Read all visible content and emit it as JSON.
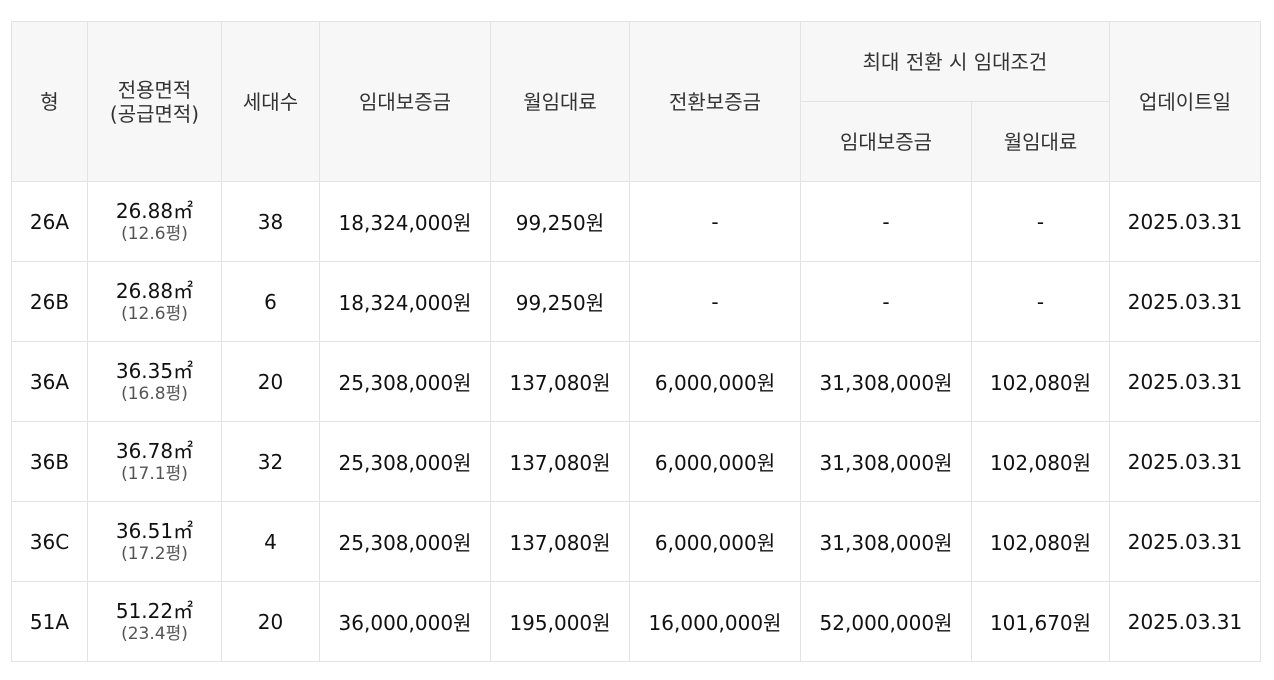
{
  "header": {
    "type": "형",
    "area_line1": "전용면적",
    "area_line2": "(공급면적)",
    "households": "세대수",
    "deposit": "임대보증금",
    "monthly_rent": "월임대료",
    "conversion_deposit": "전환보증금",
    "max_conversion_group": "최대 전환 시 임대조건",
    "max_deposit": "임대보증금",
    "max_monthly_rent": "월임대료",
    "updated": "업데이트일"
  },
  "rows": [
    {
      "type": "26A",
      "area": "26.88㎡",
      "pyeong": "(12.6평)",
      "households": "38",
      "deposit": "18,324,000원",
      "rent": "99,250원",
      "conv": "-",
      "max_deposit": "-",
      "max_rent": "-",
      "updated": "2025.03.31"
    },
    {
      "type": "26B",
      "area": "26.88㎡",
      "pyeong": "(12.6평)",
      "households": "6",
      "deposit": "18,324,000원",
      "rent": "99,250원",
      "conv": "-",
      "max_deposit": "-",
      "max_rent": "-",
      "updated": "2025.03.31"
    },
    {
      "type": "36A",
      "area": "36.35㎡",
      "pyeong": "(16.8평)",
      "households": "20",
      "deposit": "25,308,000원",
      "rent": "137,080원",
      "conv": "6,000,000원",
      "max_deposit": "31,308,000원",
      "max_rent": "102,080원",
      "updated": "2025.03.31"
    },
    {
      "type": "36B",
      "area": "36.78㎡",
      "pyeong": "(17.1평)",
      "households": "32",
      "deposit": "25,308,000원",
      "rent": "137,080원",
      "conv": "6,000,000원",
      "max_deposit": "31,308,000원",
      "max_rent": "102,080원",
      "updated": "2025.03.31"
    },
    {
      "type": "36C",
      "area": "36.51㎡",
      "pyeong": "(17.2평)",
      "households": "4",
      "deposit": "25,308,000원",
      "rent": "137,080원",
      "conv": "6,000,000원",
      "max_deposit": "31,308,000원",
      "max_rent": "102,080원",
      "updated": "2025.03.31"
    },
    {
      "type": "51A",
      "area": "51.22㎡",
      "pyeong": "(23.4평)",
      "households": "20",
      "deposit": "36,000,000원",
      "rent": "195,000원",
      "conv": "16,000,000원",
      "max_deposit": "52,000,000원",
      "max_rent": "101,670원",
      "updated": "2025.03.31"
    }
  ]
}
